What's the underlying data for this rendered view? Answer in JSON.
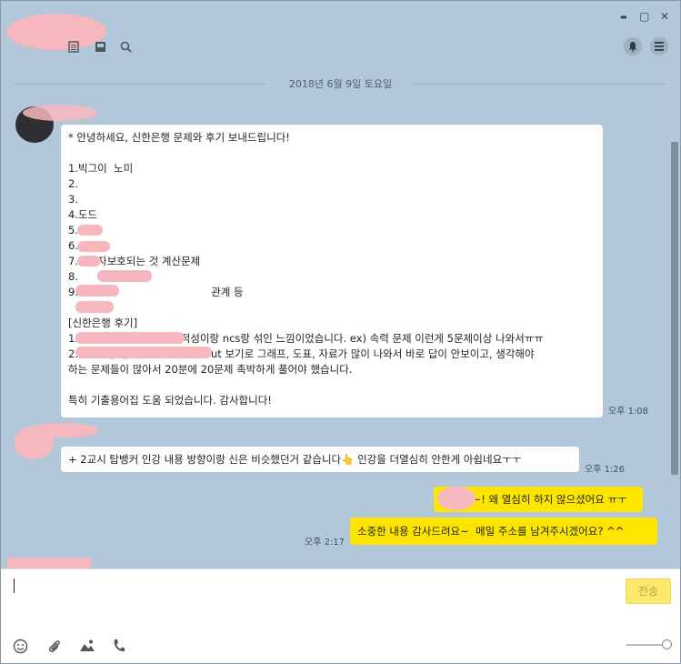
{
  "titlebar": {
    "icons": [
      "document-icon",
      "inbox-icon",
      "search-icon"
    ],
    "window_controls": [
      "minimize-icon",
      "maximize-icon",
      "close-icon"
    ],
    "right_buttons": [
      "bell-icon",
      "menu-icon"
    ],
    "minimize_glyph": "▬",
    "maximize_glyph": "▢",
    "close_glyph": "✕",
    "bell_glyph": "🔔",
    "menu_glyph": "☰"
  },
  "chat": {
    "date_divider": "2018년 6월 9일 토요일",
    "messages": [
      {
        "side": "left",
        "text": "* 안녕하세요, 신한은행 문제와 후기 보내드립니다!\n\n1.빅그이  노미\n2.\n3.\n4.도드\n5.\n6.\n7.예금자보호되는 것 계산문제\n8.\n9.                                        관계 등\n\n[신한은행 후기]\n1교시 NCS : 수리부분이 적성이랑 ncs랑 섞인 느낌이었습니다. ex) 속력 문제 이런게 5문제이상 나와서ㅠㅠ\n2교시 금융/경제 : 모두 객관식 but 보기로 그래프, 도표, 자료가 많이 나와서 바로 답이 안보이고, 생각해야\n하는 문제들이 많아서 20분에 20문제 촉박하게 풀어야 했습니다.\n\n특히 기출용어집 도움 되었습니다. 감사합니다!",
        "time": "오후 1:08"
      },
      {
        "side": "left",
        "text": "+ 2교시 탑뱅커 인강 내용 방향이랑 신은 비슷했던거 같습니다👆 인강을 더열심히 안한게 아쉽네요ㅜㅜ",
        "time": "오후 1:26"
      },
      {
        "side": "right",
        "text": "님~! 왜 열심히 하지 않으셨어요 ㅠㅜ",
        "time": ""
      },
      {
        "side": "right",
        "text": "소중한 내용 감사드려요~  메일 주소를 남겨주시겠어요? ^^",
        "time": "오후 2:17"
      }
    ]
  },
  "input": {
    "send_label": "전송",
    "bottom_icons": [
      "emoji-icon",
      "attach-icon",
      "image-icon",
      "phone-icon"
    ],
    "emoji_glyph": "☺",
    "attach_glyph": "📎",
    "image_glyph": "▲",
    "phone_glyph": "✆"
  }
}
